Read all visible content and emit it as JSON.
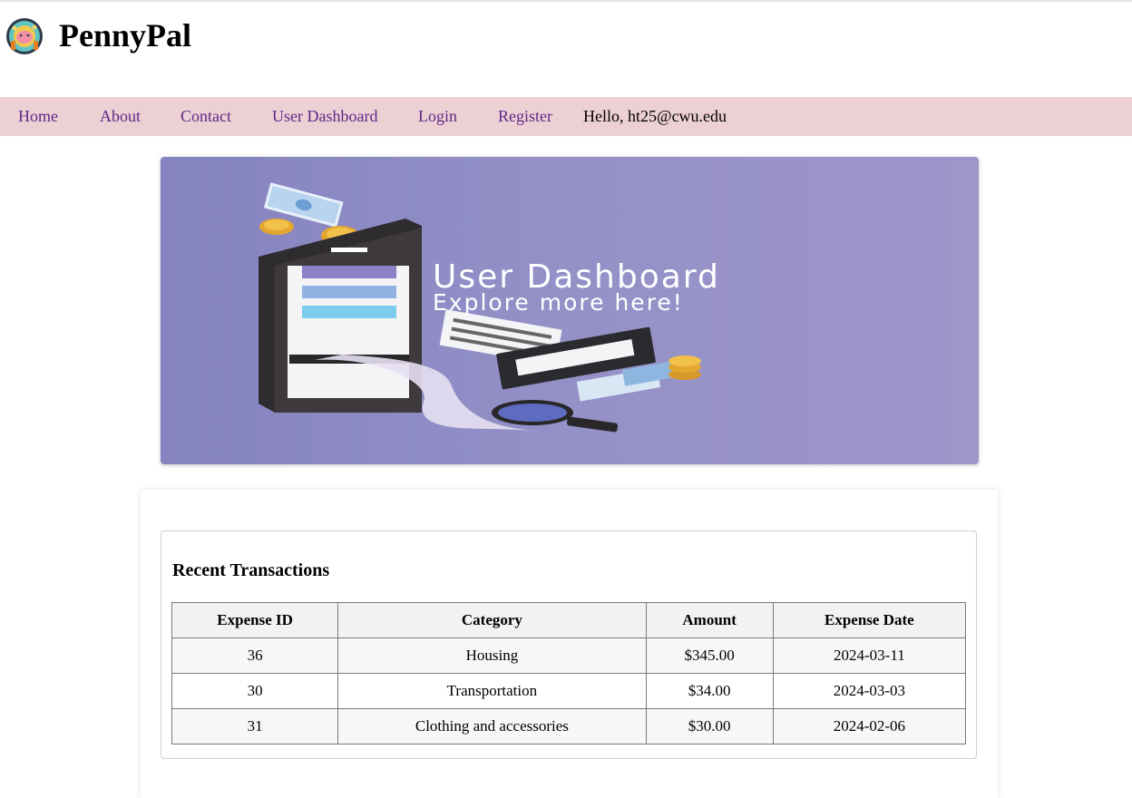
{
  "header": {
    "brand": "PennyPal",
    "logo_icon": "piggy-bank-coins-icon"
  },
  "nav": {
    "items": [
      {
        "label": "Home"
      },
      {
        "label": "About"
      },
      {
        "label": "Contact"
      },
      {
        "label": "User Dashboard"
      },
      {
        "label": "Login"
      },
      {
        "label": "Register"
      }
    ],
    "greeting": "Hello, ht25@cwu.edu",
    "link_color": "#5c2a8a",
    "background": "#ecd0d3"
  },
  "banner": {
    "title": "User Dashboard",
    "subtitle": "Explore more here!",
    "background": "#8e8bc4"
  },
  "transactions": {
    "title": "Recent Transactions",
    "columns": [
      "Expense ID",
      "Category",
      "Amount",
      "Expense Date"
    ],
    "rows": [
      [
        "36",
        "Housing",
        "$345.00",
        "2024-03-11"
      ],
      [
        "30",
        "Transportation",
        "$34.00",
        "2024-03-03"
      ],
      [
        "31",
        "Clothing and accessories",
        "$30.00",
        "2024-02-06"
      ]
    ]
  }
}
